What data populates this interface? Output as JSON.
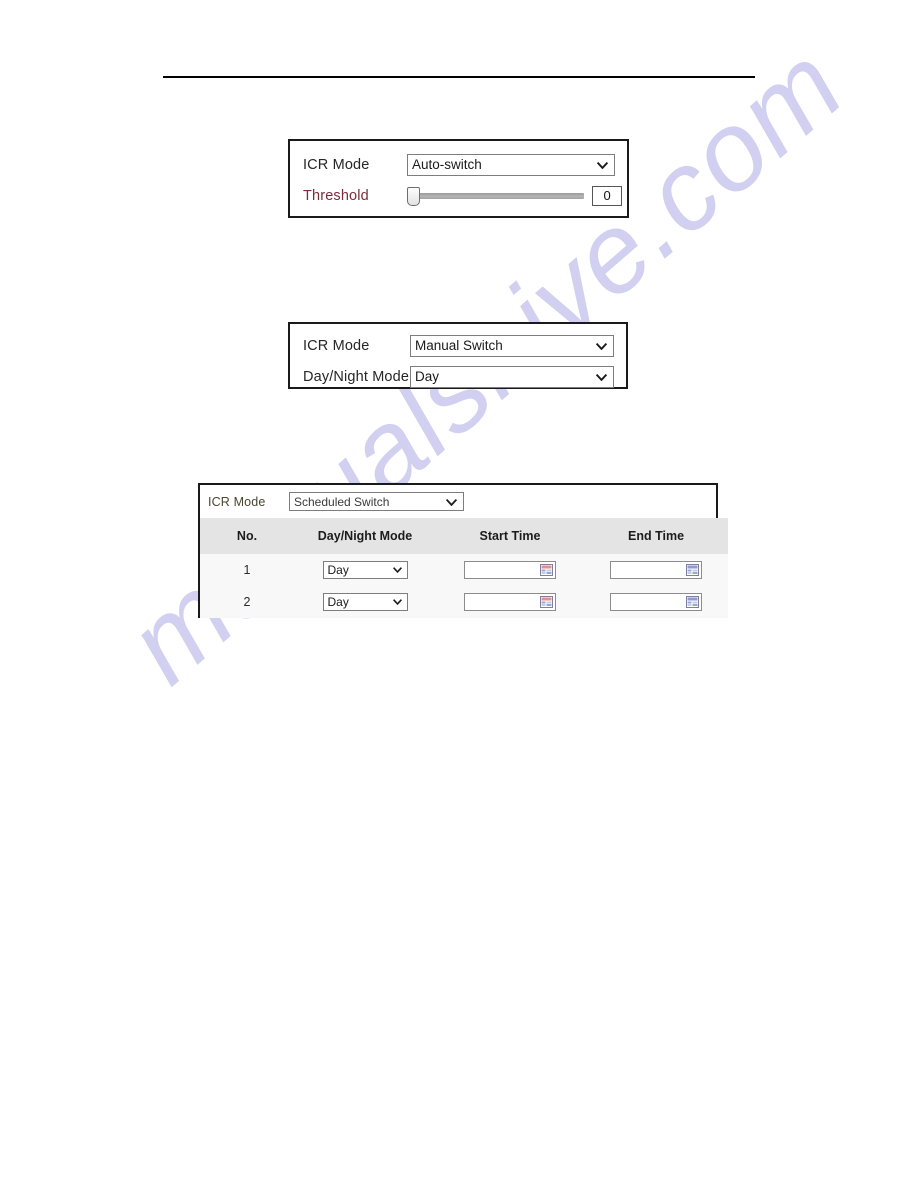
{
  "page": {
    "watermark_text": "manualshive.com",
    "watermark_color": "#c9c8ef",
    "background_color": "#ffffff",
    "rule_color": "#000000"
  },
  "figure_auto": {
    "icr_mode_label": "ICR Mode",
    "icr_mode_value": "Auto-switch",
    "threshold_label": "Threshold",
    "threshold_label_color": "#7a2d3a",
    "threshold_value": "0",
    "threshold_slider_percent": 0
  },
  "figure_manual": {
    "icr_mode_label": "ICR Mode",
    "icr_mode_value": "Manual Switch",
    "daynight_label": "Day/Night Mode",
    "daynight_value": "Day"
  },
  "figure_scheduled": {
    "icr_mode_label": "ICR Mode",
    "icr_mode_value": "Scheduled Switch",
    "columns": [
      "No.",
      "Day/Night Mode",
      "Start Time",
      "End Time"
    ],
    "rows": [
      {
        "no": "1",
        "mode": "Day",
        "start_time": "",
        "end_time": ""
      },
      {
        "no": "2",
        "mode": "Day",
        "start_time": "",
        "end_time": ""
      }
    ],
    "header_bg": "#e4e4e4",
    "row_bg": "#f8f8f8"
  }
}
